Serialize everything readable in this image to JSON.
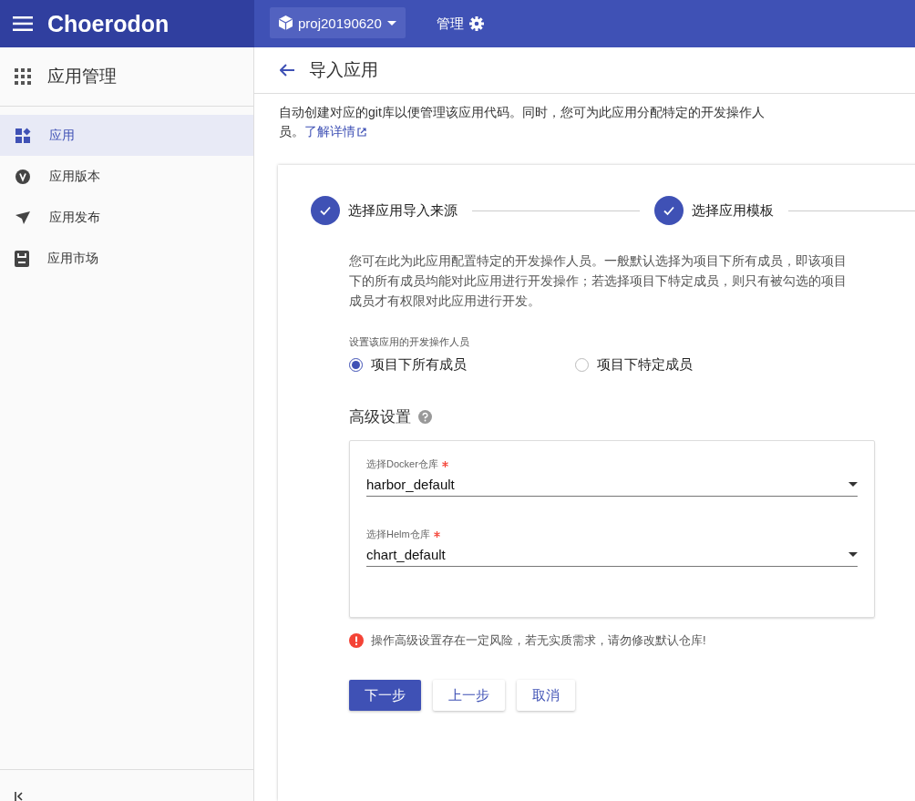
{
  "header": {
    "app_name": "Choerodon",
    "project": "proj20190620",
    "manage": "管理"
  },
  "sidebar": {
    "title": "应用管理",
    "items": [
      {
        "label": "应用",
        "selected": true
      },
      {
        "label": "应用版本",
        "selected": false
      },
      {
        "label": "应用发布",
        "selected": false
      },
      {
        "label": "应用市场",
        "selected": false
      }
    ]
  },
  "page": {
    "title": "导入应用",
    "intro": "自动创建对应的git库以便管理该应用代码。同时，您可为此应用分配特定的开发操作人员。",
    "link": "了解详情"
  },
  "steps": [
    {
      "label": "选择应用导入来源",
      "done": true
    },
    {
      "label": "选择应用模板",
      "done": true
    }
  ],
  "description": "您可在此为此应用配置特定的开发操作人员。一般默认选择为项目下所有成员，即该项目下的所有成员均能对此应用进行开发操作；若选择项目下特定成员，则只有被勾选的项目成员才有权限对此应用进行开发。",
  "member_label": "设置该应用的开发操作人员",
  "radios": [
    {
      "label": "项目下所有成员",
      "selected": true
    },
    {
      "label": "项目下特定成员",
      "selected": false
    }
  ],
  "advanced": {
    "title": "高级设置",
    "fields": [
      {
        "label": "选择Docker仓库",
        "required": true,
        "value": "harbor_default"
      },
      {
        "label": "选择Helm仓库",
        "required": true,
        "value": "chart_default"
      }
    ]
  },
  "warning": "操作高级设置存在一定风险，若无实质需求，请勿修改默认仓库!",
  "buttons": [
    {
      "label": "下一步",
      "kind": "primary"
    },
    {
      "label": "上一步",
      "kind": "secondary"
    },
    {
      "label": "取消",
      "kind": "secondary"
    }
  ]
}
